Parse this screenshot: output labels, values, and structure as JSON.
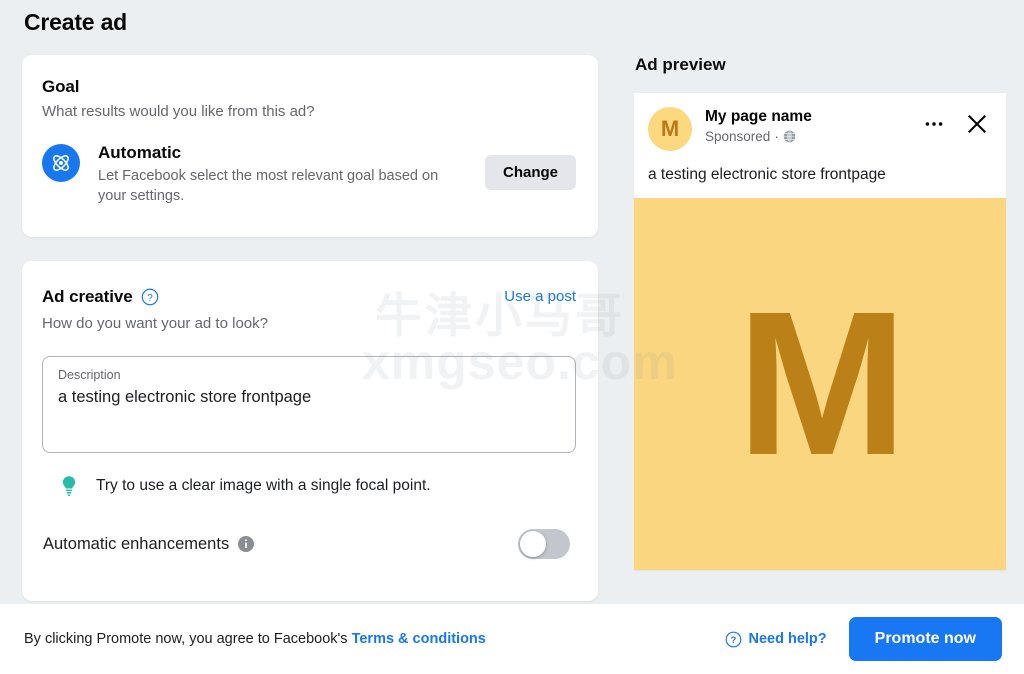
{
  "page": {
    "title": "Create ad",
    "background_color": "#eceff1"
  },
  "watermark": {
    "line1": "牛津小马哥",
    "line2": "xmgseo.com"
  },
  "goal": {
    "title": "Goal",
    "subtitle": "What results would you like from this ad?",
    "option_name": "Automatic",
    "option_description": "Let Facebook select the most relevant goal based on your settings.",
    "change_label": "Change",
    "icon": "automatic-atom-icon",
    "icon_color": "#1877f2"
  },
  "ad_creative": {
    "title": "Ad creative",
    "help_icon": "question-mark-circle-icon",
    "use_post_label": "Use a post",
    "subtitle": "How do you want your ad to look?",
    "description_label": "Description",
    "description_value": "a testing electronic store frontpage",
    "tip_icon": "lightbulb-icon",
    "tip_icon_color": "#2abba7",
    "tip_text": "Try to use a clear image with a single focal point.",
    "enhancements_label": "Automatic enhancements",
    "enhancements_info_icon": "info-circle-icon",
    "enhancements_enabled": false
  },
  "ad_preview": {
    "title": "Ad preview",
    "avatar_letter": "M",
    "avatar_bg": "#fcd87f",
    "avatar_fg": "#b9791a",
    "page_name": "My page name",
    "sponsored_label": "Sponsored",
    "meta_separator": "·",
    "audience_icon": "globe-icon",
    "more_icon": "ellipsis-icon",
    "close_icon": "close-x-icon",
    "body_text": "a testing electronic store frontpage",
    "image_letter": "M",
    "image_bg": "#fbd680",
    "image_fg": "#bb8018"
  },
  "footer": {
    "agreement_prefix": "By clicking Promote now, you agree to Facebook's ",
    "terms_link_label": "Terms & conditions",
    "need_help_label": "Need help?",
    "need_help_icon": "question-mark-circle-icon",
    "promote_label": "Promote now",
    "accent_color": "#1877f2"
  }
}
